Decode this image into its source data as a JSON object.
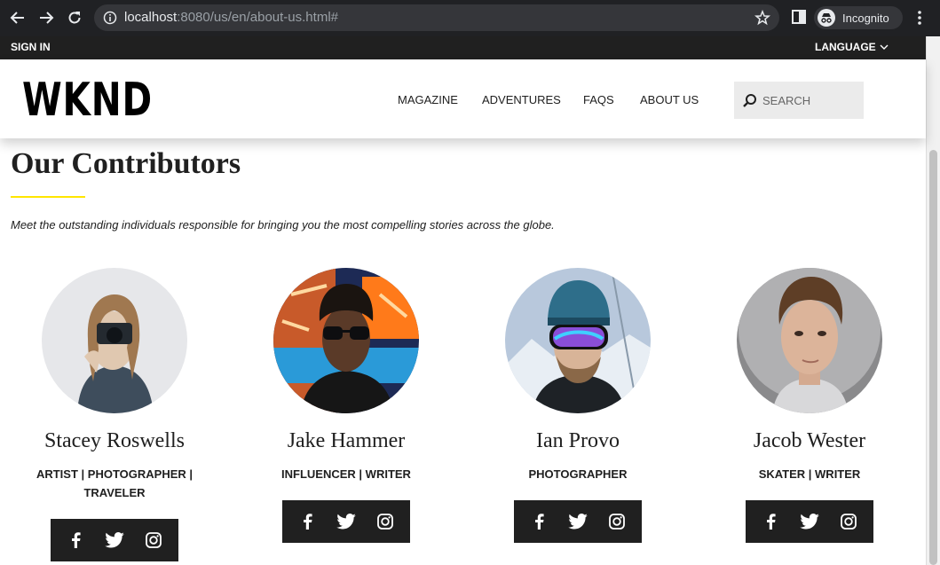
{
  "browser": {
    "url_host": "localhost",
    "url_rest": ":8080/us/en/about-us.html#",
    "incognito_label": "Incognito"
  },
  "topbar": {
    "signin": "SIGN IN",
    "language": "LANGUAGE"
  },
  "header": {
    "logo": "WKND",
    "nav": [
      "MAGAZINE",
      "ADVENTURES",
      "FAQS",
      "ABOUT US"
    ],
    "search_placeholder": "SEARCH"
  },
  "main": {
    "title": "Our Contributors",
    "intro": "Meet the outstanding individuals responsible for bringing you the most compelling stories across the globe.",
    "accent_color": "#ffe600",
    "contributors": [
      {
        "name": "Stacey Roswells",
        "role_line1": "ARTIST | PHOTOGRAPHER |",
        "role_line2": "TRAVELER"
      },
      {
        "name": "Jake Hammer",
        "role_line1": "INFLUENCER | WRITER",
        "role_line2": ""
      },
      {
        "name": "Ian Provo",
        "role_line1": "PHOTOGRAPHER",
        "role_line2": ""
      },
      {
        "name": "Jacob Wester",
        "role_line1": "SKATER | WRITER",
        "role_line2": ""
      }
    ]
  },
  "icons": [
    "facebook-icon",
    "twitter-icon",
    "instagram-icon",
    "search-icon",
    "chevron-down-icon"
  ]
}
